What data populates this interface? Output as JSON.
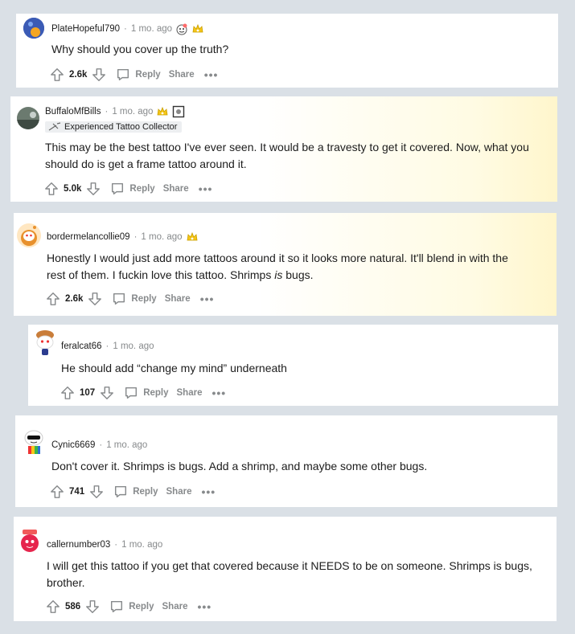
{
  "comments": [
    {
      "username": "PlateHopeful790",
      "time": "1 mo. ago",
      "awards": [
        "wholesome-seal-icon",
        "gold-crown-icon"
      ],
      "text_lines": [
        "Why should you cover up the truth?"
      ],
      "score": "2.6k",
      "reply_label": "Reply",
      "share_label": "Share"
    },
    {
      "username": "BuffaloMfBills",
      "time": "1 mo. ago",
      "awards": [
        "gold-crown-icon",
        "framed-award-icon"
      ],
      "flair": "Experienced Tattoo Collector",
      "text_lines": [
        "This may be the best tattoo I've ever seen. It would be a travesty to get it covered. Now, what you",
        "should do is get a frame tattoo around it."
      ],
      "score": "5.0k",
      "reply_label": "Reply",
      "share_label": "Share"
    },
    {
      "username": "bordermelancollie09",
      "time": "1 mo. ago",
      "awards": [
        "gold-crown-icon"
      ],
      "text_line1": "Honestly I would just add more tattoos around it so it looks more natural. It'll blend in with the",
      "text_line2_pre": "rest of them. I fuckin love this tattoo. Shrimps ",
      "text_line2_em": "is",
      "text_line2_post": " bugs.",
      "score": "2.6k",
      "reply_label": "Reply",
      "share_label": "Share"
    },
    {
      "username": "feralcat66",
      "time": "1 mo. ago",
      "text_lines": [
        "He should add “change my mind” underneath"
      ],
      "score": "107",
      "reply_label": "Reply",
      "share_label": "Share"
    },
    {
      "username": "Cynic6669",
      "time": "1 mo. ago",
      "text_lines": [
        "Don't cover it. Shrimps is bugs. Add a shrimp, and maybe some other bugs."
      ],
      "score": "741",
      "reply_label": "Reply",
      "share_label": "Share"
    },
    {
      "username": "callernumber03",
      "time": "1 mo. ago",
      "text_lines": [
        "I will get this tattoo if you get that covered because it NEEDS to be on someone. Shrimps is bugs,",
        "brother."
      ],
      "score": "586",
      "reply_label": "Reply",
      "share_label": "Share"
    }
  ],
  "separator": "·",
  "more_label": "•••",
  "colors": {
    "page_bg": "#dae0e6",
    "card_bg": "#ffffff",
    "meta_gray": "#878a8c",
    "highlight": "#fff6cc"
  }
}
